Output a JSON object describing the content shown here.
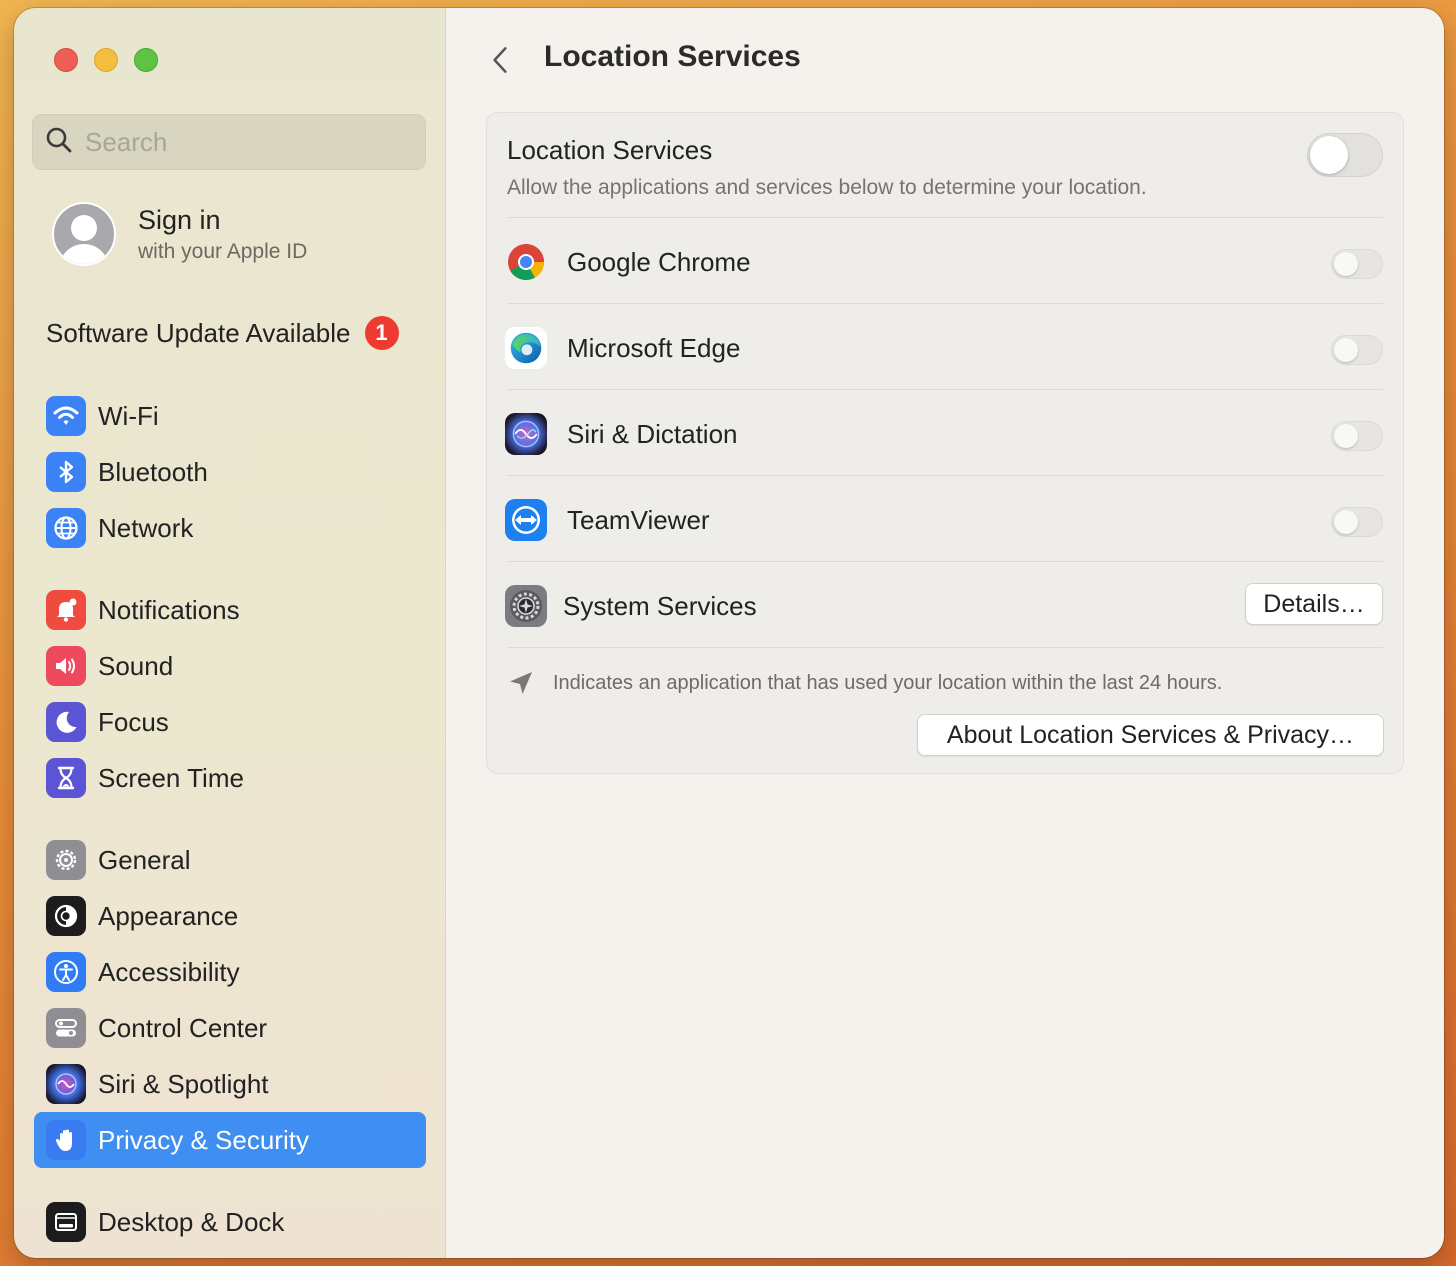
{
  "window": {
    "title": "Location Services"
  },
  "sidebar": {
    "search": {
      "placeholder": "Search"
    },
    "account": {
      "title": "Sign in",
      "subtitle": "with your Apple ID"
    },
    "update": {
      "label": "Software Update Available",
      "count": "1"
    },
    "groups": [
      [
        {
          "label": "Wi-Fi",
          "icon": "wifi-icon",
          "color": "#3b82f6"
        },
        {
          "label": "Bluetooth",
          "icon": "bluetooth-icon",
          "color": "#3b82f6"
        },
        {
          "label": "Network",
          "icon": "globe-icon",
          "color": "#3b82f6"
        }
      ],
      [
        {
          "label": "Notifications",
          "icon": "bell-icon",
          "color": "#ef4b3f"
        },
        {
          "label": "Sound",
          "icon": "speaker-icon",
          "color": "#ee4a5d"
        },
        {
          "label": "Focus",
          "icon": "moon-icon",
          "color": "#5b55d6"
        },
        {
          "label": "Screen Time",
          "icon": "hourglass-icon",
          "color": "#5b55d6"
        }
      ],
      [
        {
          "label": "General",
          "icon": "gear-icon",
          "color": "#8e8e93"
        },
        {
          "label": "Appearance",
          "icon": "appearance-icon",
          "color": "#1c1c1e"
        },
        {
          "label": "Accessibility",
          "icon": "accessibility-icon",
          "color": "#2f7cf6"
        },
        {
          "label": "Control Center",
          "icon": "control-center-icon",
          "color": "#8e8e93"
        },
        {
          "label": "Siri & Spotlight",
          "icon": "siri-icon",
          "color": "#2a2140"
        },
        {
          "label": "Privacy & Security",
          "icon": "hand-icon",
          "color": "#3a7bf2",
          "selected": true
        }
      ],
      [
        {
          "label": "Desktop & Dock",
          "icon": "dock-icon",
          "color": "#1c1c1e"
        }
      ]
    ]
  },
  "main": {
    "title": "Location Services",
    "location_services": {
      "title": "Location Services",
      "subtitle": "Allow the applications and services below to determine your location."
    },
    "apps": [
      {
        "label": "Google Chrome",
        "icon": "chrome-icon"
      },
      {
        "label": "Microsoft Edge",
        "icon": "edge-icon"
      },
      {
        "label": "Siri & Dictation",
        "icon": "siri-icon"
      },
      {
        "label": "TeamViewer",
        "icon": "teamviewer-icon"
      }
    ],
    "system_services": {
      "label": "System Services",
      "button": "Details…"
    },
    "footnote": "Indicates an application that has used your location within the last 24 hours.",
    "about_button": "About Location Services & Privacy…"
  }
}
